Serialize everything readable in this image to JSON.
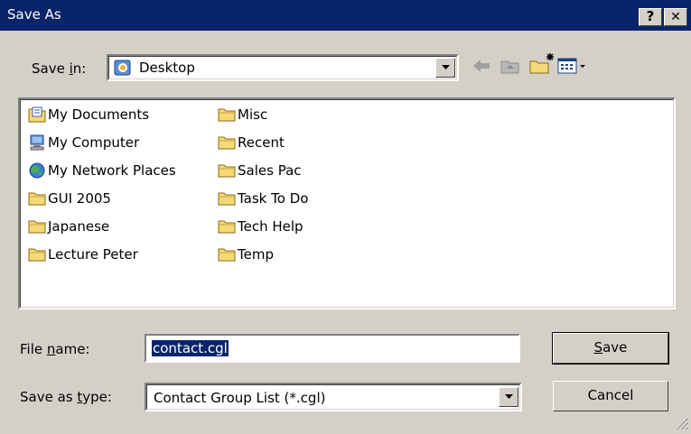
{
  "titlebar": {
    "title": "Save As",
    "help_glyph": "?",
    "close_glyph": "✕"
  },
  "location": {
    "label_pre": "Save ",
    "label_accel": "i",
    "label_post": "n:",
    "value": "Desktop",
    "icon": "desktop-icon"
  },
  "toolbar": {
    "back": "back-arrow-icon",
    "up": "up-one-level-icon",
    "new_folder": "new-folder-icon",
    "view_menu": "view-menu-icon"
  },
  "files": {
    "column1": [
      {
        "label": "My Documents",
        "icon": "my-documents-icon"
      },
      {
        "label": "My Computer",
        "icon": "my-computer-icon"
      },
      {
        "label": "My Network Places",
        "icon": "network-places-icon"
      },
      {
        "label": "GUI 2005",
        "icon": "folder-icon"
      },
      {
        "label": "Japanese",
        "icon": "folder-icon"
      },
      {
        "label": "Lecture Peter",
        "icon": "folder-icon"
      }
    ],
    "column2": [
      {
        "label": "Misc",
        "icon": "folder-icon"
      },
      {
        "label": "Recent",
        "icon": "folder-icon"
      },
      {
        "label": "Sales Pac",
        "icon": "folder-icon"
      },
      {
        "label": "Task To Do",
        "icon": "folder-icon"
      },
      {
        "label": "Tech Help",
        "icon": "folder-icon"
      },
      {
        "label": "Temp",
        "icon": "folder-icon"
      }
    ]
  },
  "filename": {
    "label_pre": "File ",
    "label_accel": "n",
    "label_post": "ame:",
    "value": "contact.cgl"
  },
  "filetype": {
    "label_pre": "Save as ",
    "label_accel": "t",
    "label_post": "ype:",
    "value": "Contact Group List (*.cgl)"
  },
  "buttons": {
    "save_accel": "S",
    "save_rest": "ave",
    "cancel": "Cancel"
  },
  "colors": {
    "title_bg": "#0a246a",
    "face": "#d4d0c8",
    "folder": "#f5d978"
  }
}
